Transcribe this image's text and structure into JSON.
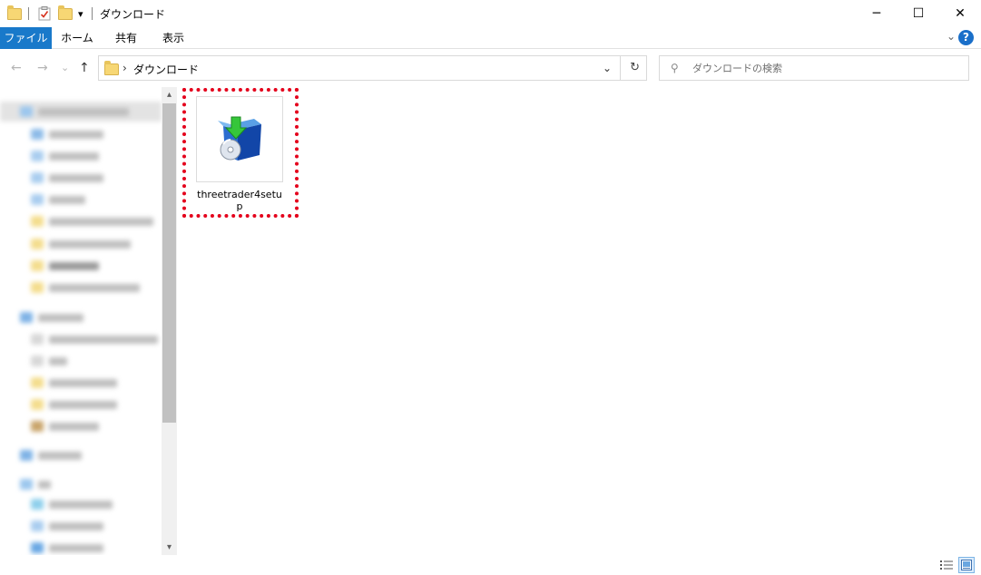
{
  "window": {
    "title": "ダウンロード",
    "qat_dropdown": "▾",
    "minimize": "─",
    "maximize": "☐",
    "close": "✕"
  },
  "ribbon": {
    "tabs": [
      {
        "label": "ファイル",
        "active": true
      },
      {
        "label": "ホーム",
        "active": false
      },
      {
        "label": "共有",
        "active": false
      },
      {
        "label": "表示",
        "active": false
      }
    ],
    "expand_chevron": "⌄",
    "help": "?"
  },
  "nav": {
    "back": "←",
    "forward": "→",
    "recent": "⌄",
    "up": "↑"
  },
  "address": {
    "separator": "›",
    "path": "ダウンロード",
    "dropdown": "⌄",
    "refresh": "↻"
  },
  "search": {
    "icon": "⚲",
    "placeholder": "ダウンロードの検索"
  },
  "scrollbar": {
    "up": "▴",
    "down": "▾"
  },
  "files": [
    {
      "name": "threetrader4setup",
      "icon": "installer-box-icon"
    }
  ],
  "colors": {
    "accent": "#1979ca",
    "highlight": "#e4001b",
    "folder": "#f7d774"
  }
}
